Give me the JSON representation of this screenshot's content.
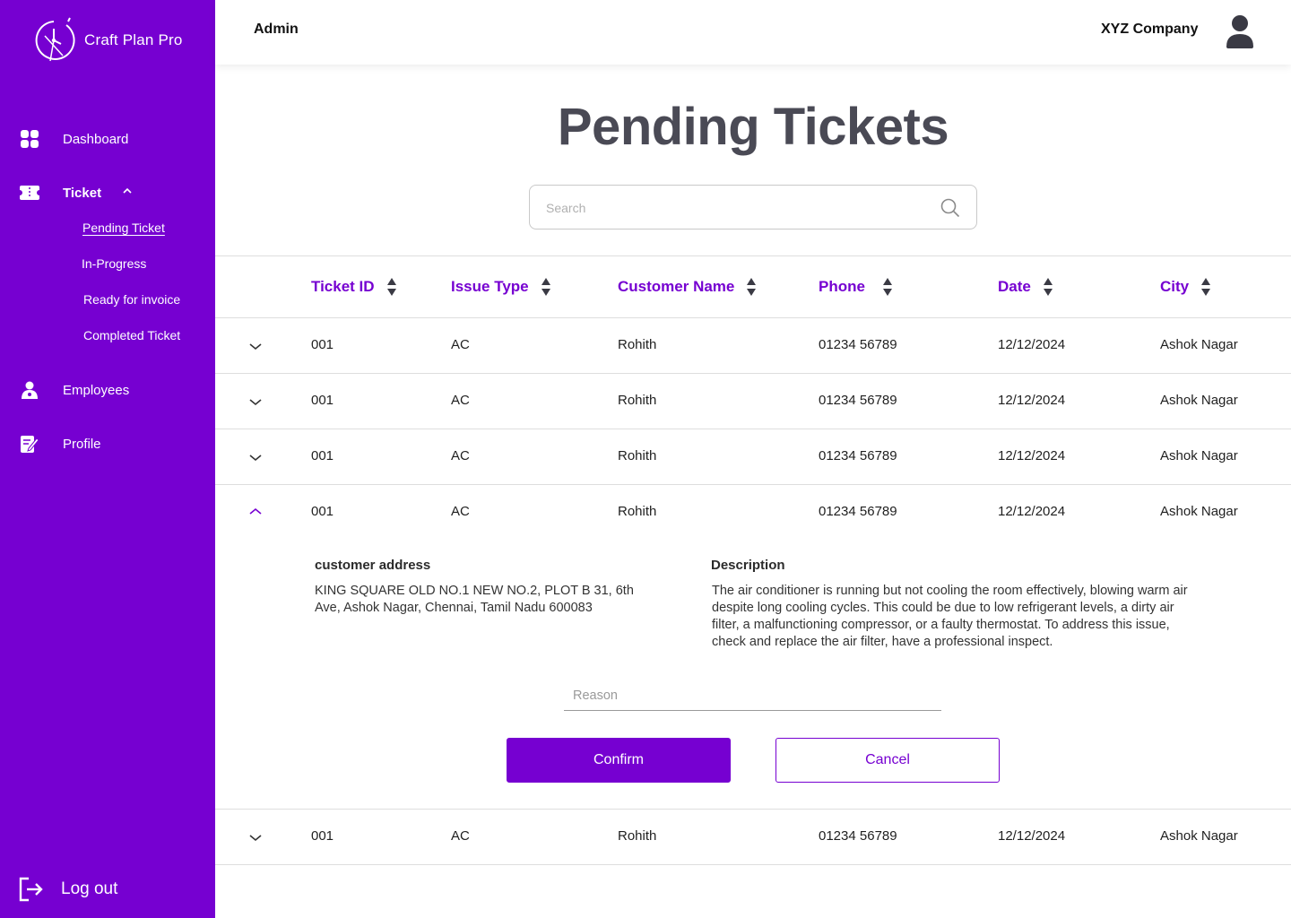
{
  "app": {
    "name": "Craft Plan Pro"
  },
  "sidebar": {
    "items": [
      {
        "label": "Dashboard"
      },
      {
        "label": "Ticket"
      },
      {
        "label": "Employees"
      },
      {
        "label": "Profile"
      }
    ],
    "ticket_subitems": [
      {
        "label": "Pending Ticket"
      },
      {
        "label": "In-Progress"
      },
      {
        "label": "Ready for invoice"
      },
      {
        "label": "Completed Ticket"
      }
    ],
    "logout_label": "Log out"
  },
  "header": {
    "role": "Admin",
    "company": "XYZ Company"
  },
  "page": {
    "title": "Pending Tickets"
  },
  "search": {
    "placeholder": "Search",
    "value": ""
  },
  "table": {
    "columns": [
      "Ticket ID",
      "Issue Type",
      "Customer Name",
      "Phone",
      "Date",
      "City"
    ],
    "rows": [
      {
        "id": "001",
        "issue": "AC",
        "customer": "Rohith",
        "phone": "01234 56789",
        "date": "12/12/2024",
        "city": "Ashok Nagar",
        "expanded": false
      },
      {
        "id": "001",
        "issue": "AC",
        "customer": "Rohith",
        "phone": "01234 56789",
        "date": "12/12/2024",
        "city": "Ashok Nagar",
        "expanded": false
      },
      {
        "id": "001",
        "issue": "AC",
        "customer": "Rohith",
        "phone": "01234 56789",
        "date": "12/12/2024",
        "city": "Ashok Nagar",
        "expanded": false
      },
      {
        "id": "001",
        "issue": "AC",
        "customer": "Rohith",
        "phone": "01234 56789",
        "date": "12/12/2024",
        "city": "Ashok Nagar",
        "expanded": true
      },
      {
        "id": "001",
        "issue": "AC",
        "customer": "Rohith",
        "phone": "01234 56789",
        "date": "12/12/2024",
        "city": "Ashok Nagar",
        "expanded": false
      }
    ]
  },
  "detail": {
    "address_label": "customer address",
    "address_line1": "KING SQUARE OLD NO.1 NEW NO.2, PLOT B 31, 6th",
    "address_line2": "Ave, Ashok Nagar, Chennai, Tamil Nadu 600083",
    "description_label": "Description",
    "description_line1": "The air conditioner is running but not cooling the room effectively, blowing warm air",
    "description_line2": "despite long cooling cycles. This could be due to low refrigerant levels, a dirty air",
    "description_line3": "filter, a malfunctioning compressor, or a faulty thermostat. To address this issue,",
    "description_line4": "check and replace the air filter, have a professional inspect.",
    "reason_placeholder": "Reason",
    "reason_value": "",
    "confirm_label": "Confirm",
    "cancel_label": "Cancel"
  },
  "colors": {
    "brand": "#7600d1",
    "title": "#4a4a55",
    "border": "#dedede"
  },
  "icons": [
    "clock-logo-icon",
    "dashboard-grid-icon",
    "ticket-icon",
    "chevron-up-icon",
    "employee-icon",
    "profile-edit-icon",
    "logout-icon",
    "user-avatar-icon",
    "search-icon",
    "sort-icon",
    "chevron-down-icon"
  ]
}
